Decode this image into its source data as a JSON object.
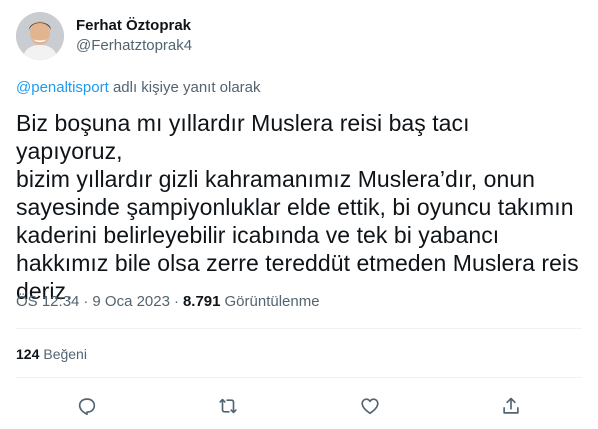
{
  "author": {
    "display_name": "Ferhat Öztoprak",
    "handle": "@Ferhatztoprak4",
    "avatar_icon": "profile-photo-avatar"
  },
  "reply": {
    "mention": "@penaltisport",
    "suffix": " adlı kişiye yanıt olarak"
  },
  "tweet": {
    "text": "Biz boşuna mı yıllardır Muslera reisi baş tacı yapıyoruz,\nbizim yıllardır gizli kahramanımız Muslera’dır, onun\nsayesinde şampiyonluklar elde ettik, bi oyuncu takımın\nkaderini belirleyebilir icabında ve tek bi yabancı\nhakkımız bile olsa zerre tereddüt etmeden Muslera reis\nderiz.",
    "time": "ÖS 12:34",
    "separator": "·",
    "date": "9 Oca 2023",
    "views_count": "8.791",
    "views_label": "Görüntülenme"
  },
  "stats": {
    "likes_count": "124",
    "likes_label": "Beğeni"
  },
  "actions": [
    {
      "name": "reply",
      "icon": "speech-bubble-icon"
    },
    {
      "name": "retweet",
      "icon": "retweet-arrows-icon"
    },
    {
      "name": "like",
      "icon": "heart-icon"
    },
    {
      "name": "share",
      "icon": "share-upload-icon"
    }
  ],
  "colors": {
    "text": "#0f1419",
    "secondary": "#536471",
    "link": "#1d9bf0",
    "divider": "#eff3f4"
  }
}
